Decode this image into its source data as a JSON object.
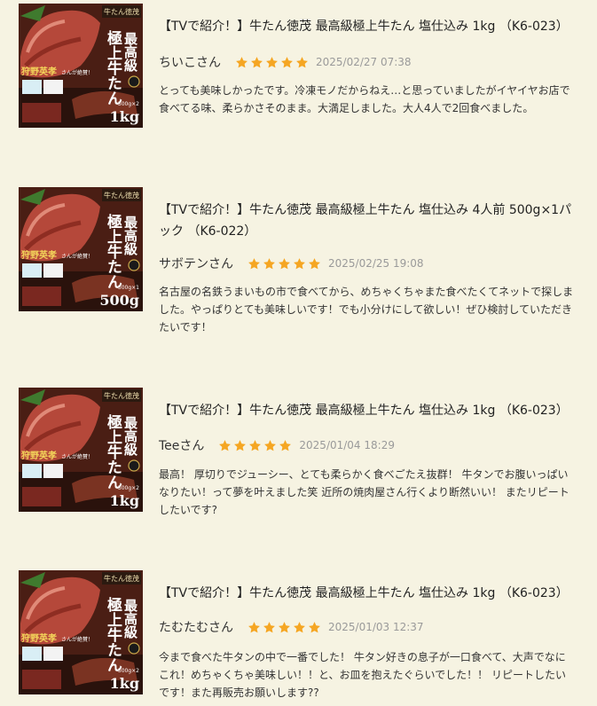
{
  "colors": {
    "background": "#f6f3e2",
    "star": "#f5a623",
    "date_text": "#9a9a9a"
  },
  "star_icon": "star-icon",
  "reviews": [
    {
      "product_title": "【TVで紹介！】牛たん徳茂 最高級極上牛たん 塩仕込み 1kg （K6-023）",
      "reviewer": "ちいこさん",
      "rating": 5,
      "date": "2025/02/27 07:38",
      "body": "とっても美味しかったです。冷凍モノだからねえ…と思っていましたがイヤイヤお店で食べてる味、柔らかさそのまま。大満足しました。大人4人で2回食べました。",
      "image": {
        "brand": "牛たん徳茂",
        "headline_1": "最高級",
        "headline_2": "極上牛たん",
        "endorser": "狩野英孝",
        "endorser_note": "さんが絶賛！",
        "pack_note": "500g×2",
        "weight": "1kg"
      }
    },
    {
      "product_title": "【TVで紹介！】牛たん徳茂 最高級極上牛たん 塩仕込み 4人前 500g×1パック （K6-022）",
      "reviewer": "サボテンさん",
      "rating": 5,
      "date": "2025/02/25 19:08",
      "body": "名古屋の名鉄うまいもの市で食べてから、めちゃくちゃまた食べたくてネットで探しました。やっぱりとても美味しいです！でも小分けにして欲しい！ぜひ検討していただきたいです！",
      "image": {
        "brand": "牛たん徳茂",
        "headline_1": "最高級",
        "headline_2": "極上牛たん",
        "endorser": "狩野英孝",
        "endorser_note": "さんが絶賛！",
        "pack_note": "500g×1",
        "weight": "500g"
      }
    },
    {
      "product_title": "【TVで紹介！】牛たん徳茂 最高級極上牛たん 塩仕込み 1kg （K6-023）",
      "reviewer": "Teeさん",
      "rating": 5,
      "date": "2025/01/04 18:29",
      "body": "最高！ 厚切りでジューシー、とても柔らかく食べごたえ抜群！ 牛タンでお腹いっぱいなりたい！って夢を叶えました笑 近所の焼肉屋さん行くより断然いい！ またリピートしたいです?",
      "image": {
        "brand": "牛たん徳茂",
        "headline_1": "最高級",
        "headline_2": "極上牛たん",
        "endorser": "狩野英孝",
        "endorser_note": "さんが絶賛！",
        "pack_note": "500g×2",
        "weight": "1kg"
      }
    },
    {
      "product_title": "【TVで紹介！】牛たん徳茂 最高級極上牛たん 塩仕込み 1kg （K6-023）",
      "reviewer": "たむたむさん",
      "rating": 5,
      "date": "2025/01/03 12:37",
      "body": "今まで食べた牛タンの中で一番でした！ 牛タン好きの息子が一口食べて、大声でなにこれ！めちゃくちゃ美味しい！！と、お皿を抱えたぐらいでした！！ リピートしたいです！また再販売お願いします??",
      "image": {
        "brand": "牛たん徳茂",
        "headline_1": "最高級",
        "headline_2": "極上牛たん",
        "endorser": "狩野英孝",
        "endorser_note": "さんが絶賛！",
        "pack_note": "500g×2",
        "weight": "1kg"
      }
    }
  ]
}
